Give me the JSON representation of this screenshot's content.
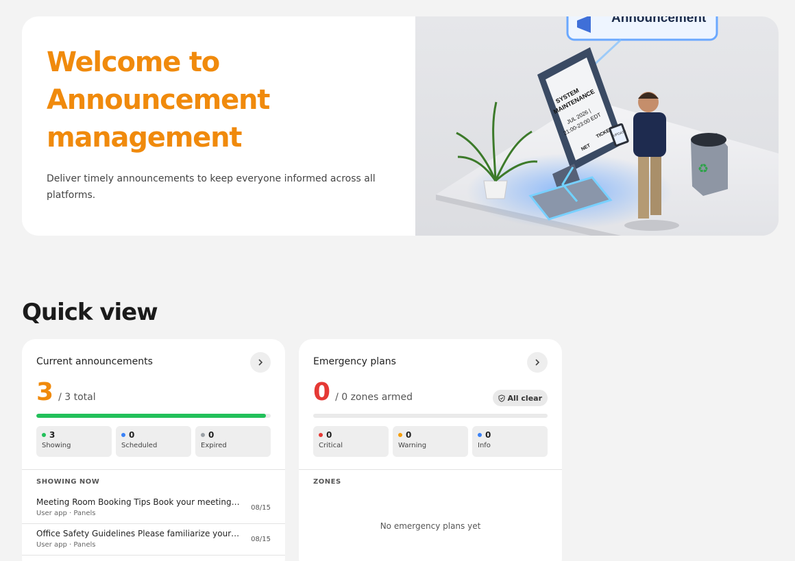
{
  "hero": {
    "title_lines": [
      "Welcome to",
      "Announcement",
      "management"
    ],
    "description": "Deliver timely announcements to keep everyone informed across all platforms.",
    "image": {
      "banner": "Announcement",
      "screen_line1": "SYSTEM",
      "screen_line2": "MAINTENANCE",
      "screen_line3": "JUL 2026 |",
      "screen_line4": "21:00-23:00 EDT",
      "screen_net": "NET",
      "screen_tickets": "TICKETS",
      "tablet": "UPDATE"
    }
  },
  "quick_view": {
    "title": "Quick view",
    "announcements": {
      "title": "Current announcements",
      "count": "3",
      "total_label": "/ 3 total",
      "progress": 0.98,
      "stats": [
        {
          "value": "3",
          "label": "Showing",
          "color": "#22c05a"
        },
        {
          "value": "0",
          "label": "Scheduled",
          "color": "#3b82f6"
        },
        {
          "value": "0",
          "label": "Expired",
          "color": "#9aa0a6"
        }
      ],
      "list_header": "SHOWING NOW",
      "items": [
        {
          "title": "Meeting Room Booking Tips Book your meeting ...",
          "meta": "User app · Panels",
          "date": "08/15"
        },
        {
          "title": "Office Safety Guidelines Please familiarize yours...",
          "meta": "User app · Panels",
          "date": "08/15"
        }
      ]
    },
    "emergency": {
      "title": "Emergency plans",
      "count": "0",
      "zones_label": "/ 0 zones armed",
      "badge": "All clear",
      "progress": 0,
      "stats": [
        {
          "value": "0",
          "label": "Critical",
          "color": "#e53935"
        },
        {
          "value": "0",
          "label": "Warning",
          "color": "#f59e0b"
        },
        {
          "value": "0",
          "label": "Info",
          "color": "#3b82f6"
        }
      ],
      "list_header": "ZONES",
      "empty": "No emergency plans yet"
    }
  },
  "colors": {
    "accent": "#f08a0c",
    "danger": "#e53935",
    "success": "#22c05a"
  }
}
